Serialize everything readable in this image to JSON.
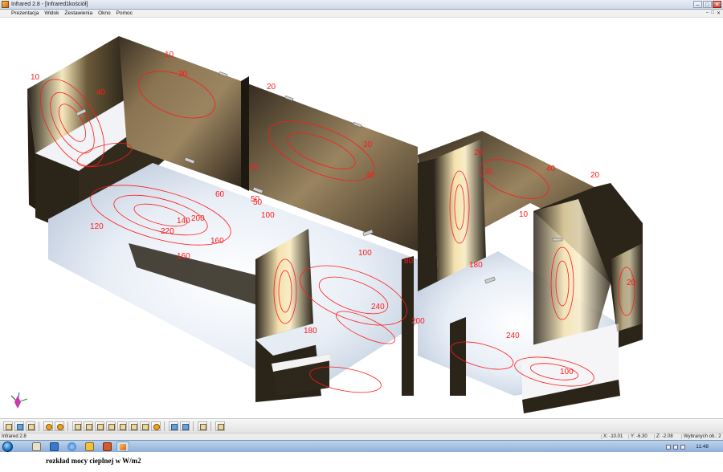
{
  "window": {
    "title": "Infrared 2.8 - [Infrared1kościół]",
    "controls": [
      "–",
      "□",
      "✕"
    ]
  },
  "menu": {
    "items": [
      "Prezentacja",
      "Widok",
      "Zestawienia",
      "Okno",
      "Pomoc"
    ],
    "mdi_controls": [
      "–",
      "□",
      "✕"
    ]
  },
  "viewport": {
    "contour_labels": [
      {
        "id": "l1",
        "text": "10"
      },
      {
        "id": "l2",
        "text": "40"
      },
      {
        "id": "l3",
        "text": "30"
      },
      {
        "id": "l4",
        "text": "20"
      },
      {
        "id": "l5",
        "text": "30"
      },
      {
        "id": "l6",
        "text": "20"
      },
      {
        "id": "l7",
        "text": "50"
      },
      {
        "id": "l8",
        "text": "40"
      },
      {
        "id": "l9",
        "text": "60"
      },
      {
        "id": "l10",
        "text": "100"
      },
      {
        "id": "l11",
        "text": "140"
      },
      {
        "id": "l12",
        "text": "160"
      },
      {
        "id": "l13",
        "text": "200"
      },
      {
        "id": "l14",
        "text": "220"
      },
      {
        "id": "l15",
        "text": "180"
      },
      {
        "id": "l16",
        "text": "240"
      },
      {
        "id": "l17",
        "text": "100"
      },
      {
        "id": "l18",
        "text": "240"
      },
      {
        "id": "l19",
        "text": "200"
      },
      {
        "id": "l20",
        "text": "20"
      },
      {
        "id": "l21",
        "text": "10"
      },
      {
        "id": "l22",
        "text": "40"
      },
      {
        "id": "l23",
        "text": "20"
      },
      {
        "id": "l24",
        "text": "10"
      },
      {
        "id": "l25",
        "text": "30"
      },
      {
        "id": "l26",
        "text": "20"
      },
      {
        "id": "l27",
        "text": "180"
      },
      {
        "id": "l28",
        "text": "160"
      },
      {
        "id": "l29",
        "text": "120"
      },
      {
        "id": "l30",
        "text": "80"
      },
      {
        "id": "l31",
        "text": "100"
      },
      {
        "id": "l32",
        "text": "50"
      }
    ]
  },
  "toolbar": {
    "buttons": [
      "edit",
      "save",
      "print",
      "open",
      "view-1",
      "view-2",
      "view-3",
      "view-4",
      "view-5",
      "view-6",
      "view-7",
      "view-8",
      "render",
      "refresh",
      "windows",
      "export"
    ]
  },
  "status": {
    "app": "Infrared 2.8",
    "x": "X: -10.01",
    "y": "Y: -6.30",
    "z": "Z: -2.08",
    "selected": "Wybranych ob.: 2"
  },
  "taskbar": {
    "clock": "11:48"
  },
  "caption": "rozkład mocy cieplnej w W/m2",
  "colors": {
    "contour": "#ff1a1a",
    "wall_dark": "#2e281d",
    "wall_warm": "#f3e3b4",
    "floor": "#dfe7f1"
  }
}
